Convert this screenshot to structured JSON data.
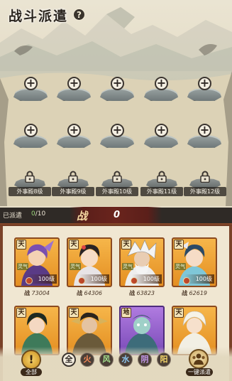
{
  "header": {
    "title": "战斗派遣",
    "help_label": "?"
  },
  "slots": {
    "empty_symbol": "+",
    "locked": [
      {
        "label": "外事殿8级"
      },
      {
        "label": "外事殿9级"
      },
      {
        "label": "外事殿10级"
      },
      {
        "label": "外事殿11级"
      },
      {
        "label": "外事殿12级"
      }
    ]
  },
  "dispatch": {
    "label": "已派遣",
    "count": "0",
    "max": "/10",
    "power_label": "战",
    "power_value": "0"
  },
  "heroes": [
    {
      "tier": "天",
      "element": "灵气",
      "level": "100级",
      "power_label": "战",
      "power": "73004",
      "rarity": "orange"
    },
    {
      "tier": "天",
      "element": "灵气",
      "level": "100级",
      "power_label": "战",
      "power": "64306",
      "rarity": "orange"
    },
    {
      "tier": "天",
      "element": "灵气",
      "level": "100级",
      "power_label": "战",
      "power": "63823",
      "rarity": "orange"
    },
    {
      "tier": "天",
      "element": "灵气",
      "level": "100级",
      "power_label": "战",
      "power": "62619",
      "rarity": "orange"
    },
    {
      "tier": "天",
      "element": "",
      "level": "",
      "power_label": "",
      "power": "",
      "rarity": "orange"
    },
    {
      "tier": "天",
      "element": "",
      "level": "",
      "power_label": "",
      "power": "",
      "rarity": "orange"
    },
    {
      "tier": "地",
      "element": "",
      "level": "",
      "power_label": "",
      "power": "",
      "rarity": "purple"
    },
    {
      "tier": "天",
      "element": "",
      "level": "",
      "power_label": "",
      "power": "",
      "rarity": "orange"
    }
  ],
  "filters": {
    "all_icon": "!",
    "all_label": "全部",
    "elements": [
      "全",
      "火",
      "风",
      "水",
      "阴",
      "阳"
    ],
    "onekey_label": "一键派遣"
  }
}
